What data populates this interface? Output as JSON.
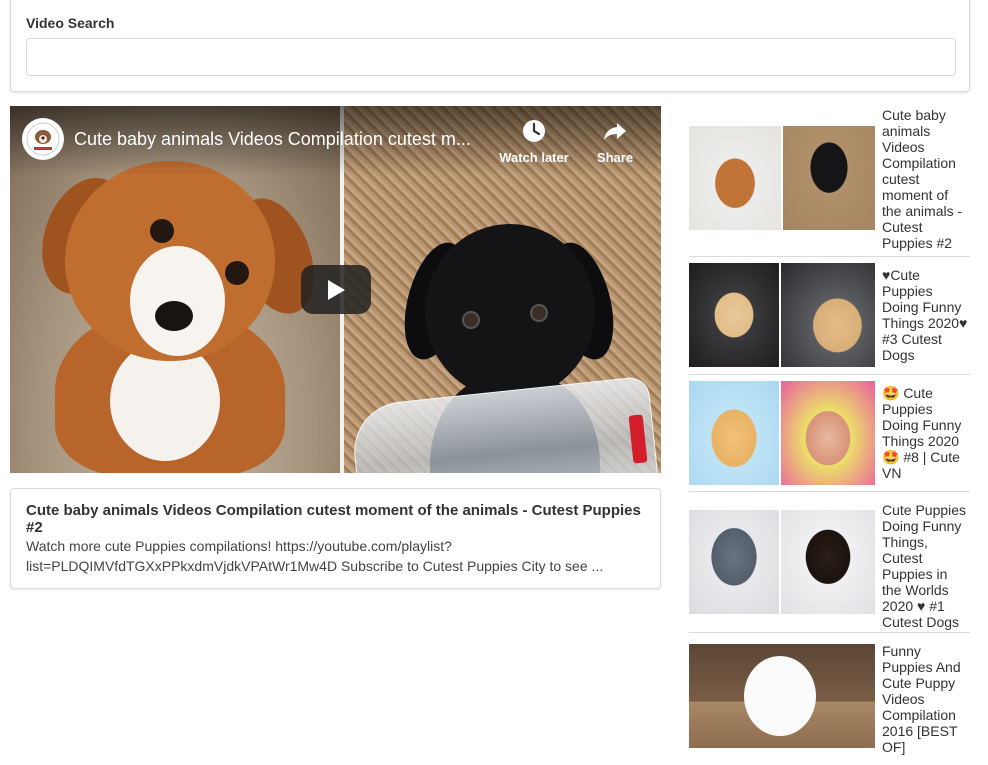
{
  "search": {
    "label": "Video Search",
    "value": "",
    "placeholder": ""
  },
  "player": {
    "title": "Cute baby animals Videos Compilation cutest m...",
    "watch_later_label": "Watch later",
    "share_label": "Share",
    "icons": {
      "channel": "channel-avatar-icon",
      "watch_later": "clock-icon",
      "share": "share-arrow-icon",
      "play": "play-icon"
    }
  },
  "details": {
    "title": "Cute baby animals Videos Compilation cutest moment of the animals - Cutest Puppies #2",
    "description": "Watch more cute Puppies compilations! https://youtube.com/playlist?list=PLDQIMVfdTGXxPPkxdmVjdkVPAtWr1Mw4D Subscribe to Cutest Puppies City to see ..."
  },
  "video_list": [
    {
      "title": "Cute baby animals Videos Compilation cutest moment of the animals - Cutest Puppies #2"
    },
    {
      "title": "♥Cute Puppies Doing Funny Things 2020♥ #3 Cutest Dogs"
    },
    {
      "title": "🤩 Cute Puppies Doing Funny Things 2020 🤩 #8 | Cute VN"
    },
    {
      "title": "Cute Puppies Doing Funny Things, Cutest Puppies in the Worlds 2020 ♥ #1 Cutest Dogs"
    },
    {
      "title": "Funny Puppies And Cute Puppy Videos Compilation 2016 [BEST OF]"
    }
  ],
  "colors": {
    "border": "#dcdcdc",
    "text": "#333333",
    "play_button_bg": "#212121"
  }
}
